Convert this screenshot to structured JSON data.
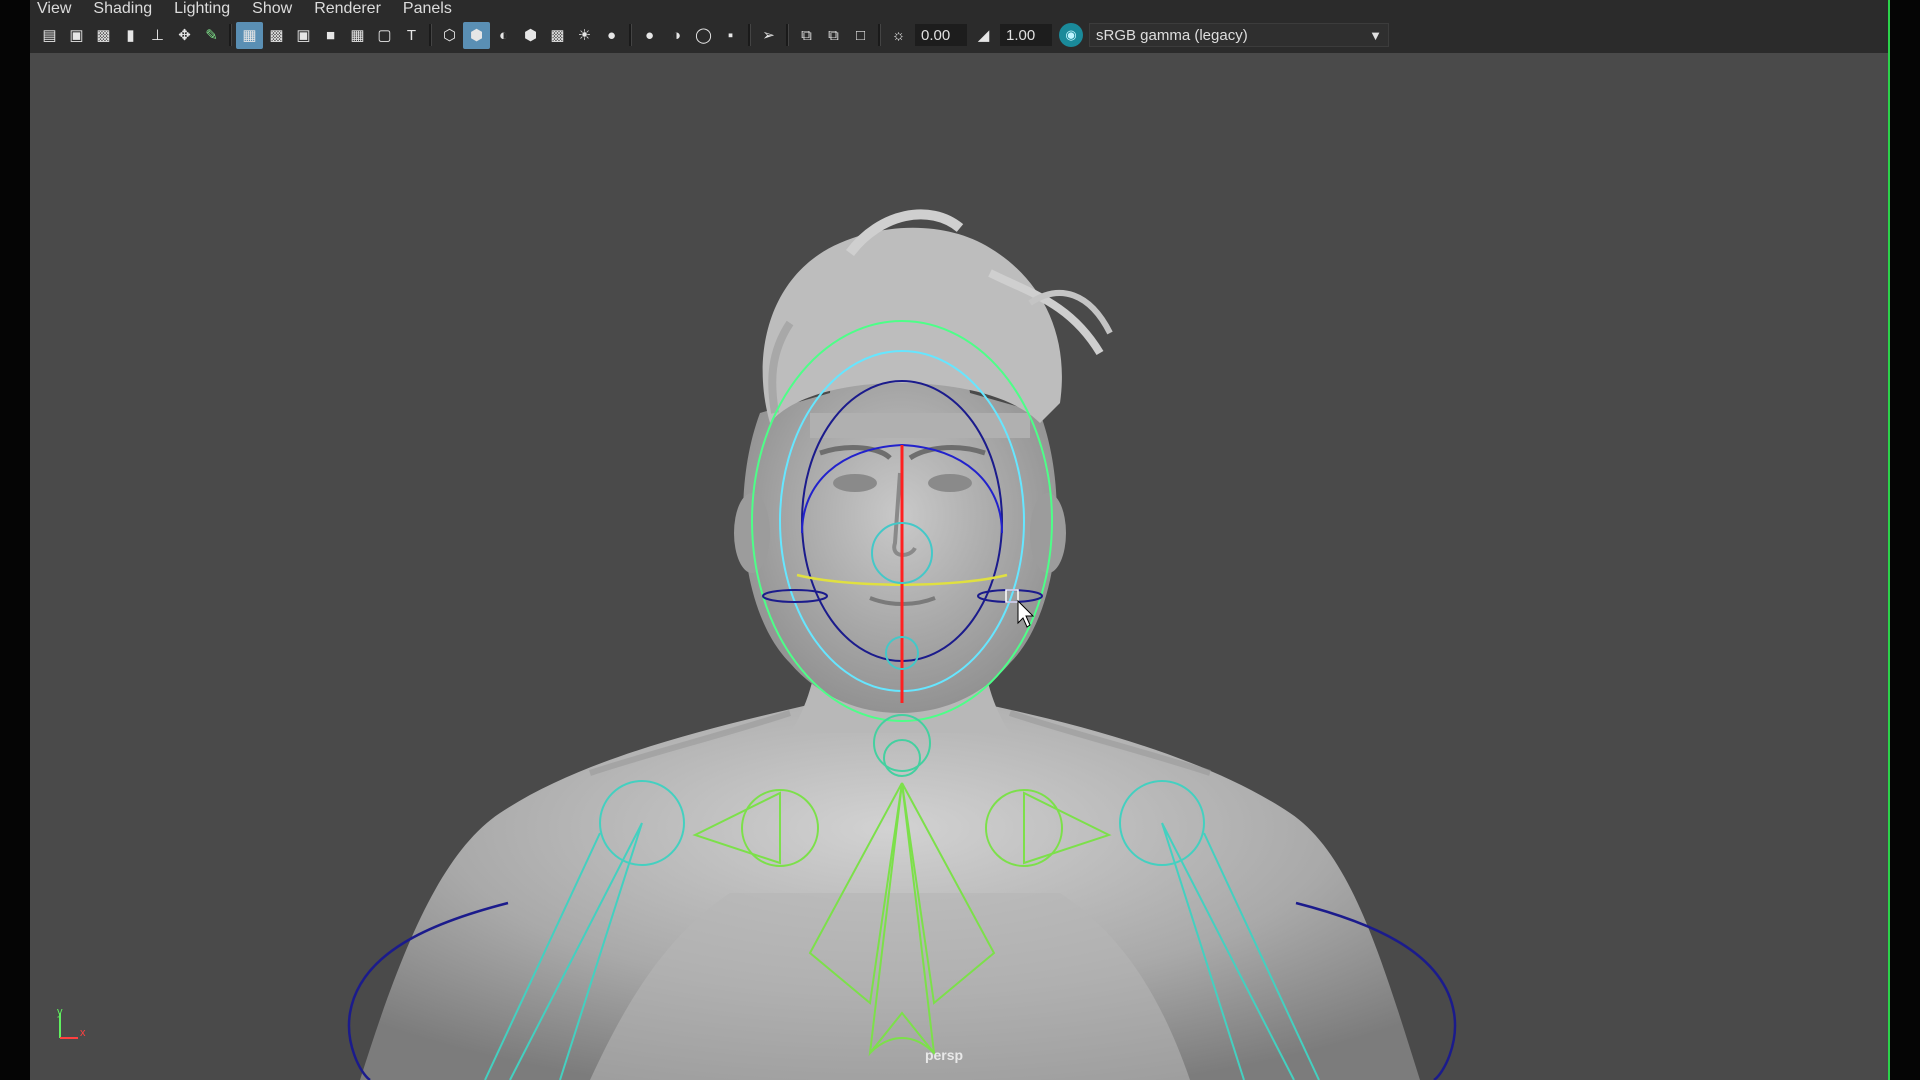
{
  "menu": {
    "items": [
      "View",
      "Shading",
      "Lighting",
      "Show",
      "Renderer",
      "Panels"
    ]
  },
  "toolbar": {
    "icons_group1": [
      "camera-select-icon",
      "camera-lock-icon",
      "camera-attributes-icon",
      "bookmark-icon",
      "image-plane-icon",
      "2d-pan-zoom-icon",
      "grease-pencil-icon"
    ],
    "icons_group2": [
      "grid-icon",
      "film-gate-icon",
      "resolution-gate-icon",
      "gate-mask-icon",
      "field-chart-icon",
      "safe-action-icon",
      "safe-title-icon"
    ],
    "icons_group3": [
      "wireframe-icon",
      "smooth-shade-icon",
      "default-material-icon",
      "shaded-wireframe-icon",
      "textured-icon",
      "use-all-lights-icon",
      "shadows-icon"
    ],
    "icons_group4": [
      "screen-space-ao-icon",
      "motion-blur-icon",
      "multisample-aa-icon",
      "depth-of-field-icon"
    ],
    "icons_group5": [
      "isolate-select-icon",
      "xray-icon",
      "xray-joints-icon",
      "xray-components-icon"
    ],
    "exposure_value": "0.00",
    "gamma_value": "1.00",
    "color_space": "sRGB gamma (legacy)"
  },
  "viewport": {
    "camera_label": "persp",
    "axis_x": "x",
    "axis_y": "y"
  }
}
